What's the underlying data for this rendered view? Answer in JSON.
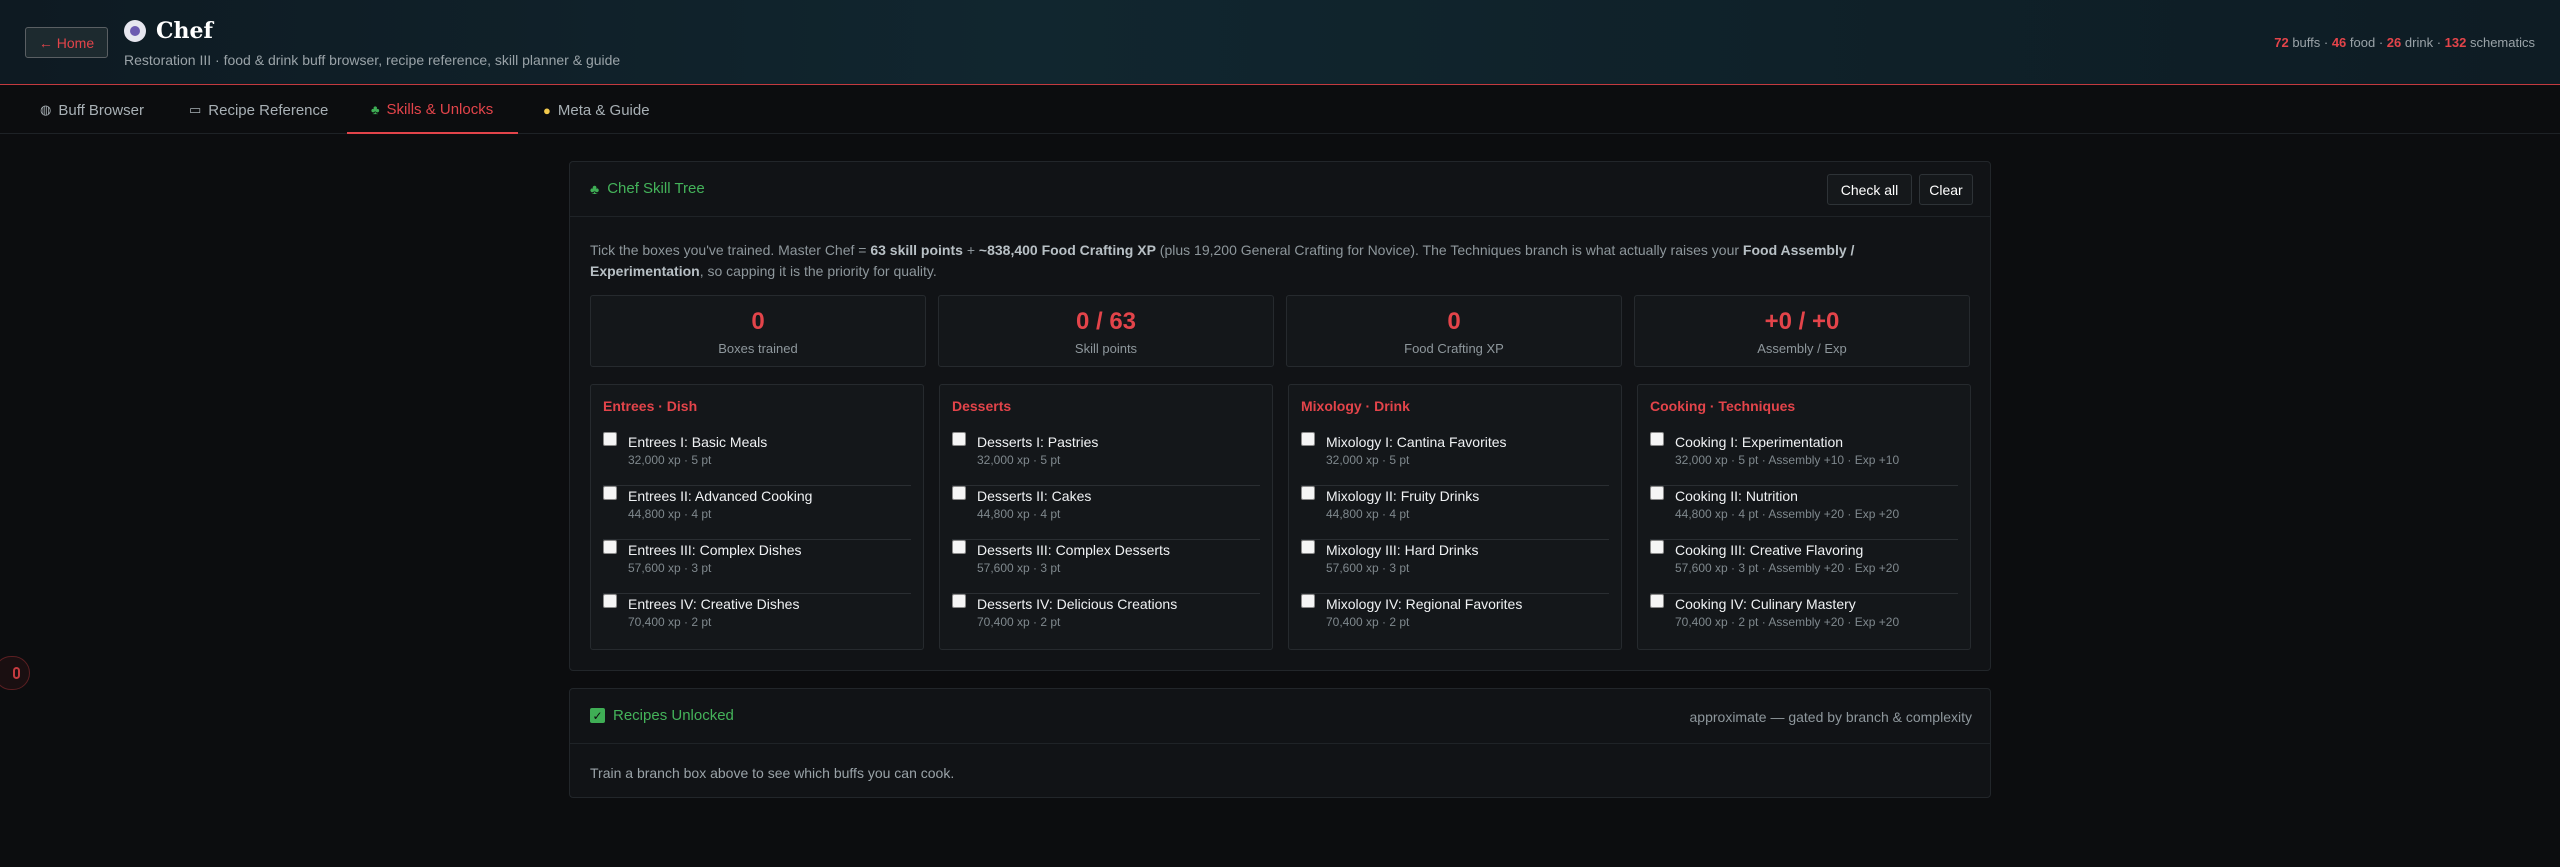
{
  "header": {
    "home_label": "← Home",
    "title": "Chef",
    "subtitle": "Restoration III · food & drink buff browser, recipe reference, skill planner & guide",
    "stats": {
      "buffs_count": "72",
      "buffs_label": "buffs",
      "food_count": "46",
      "food_label": "food",
      "drink_count": "26",
      "drink_label": "drink",
      "schematics_count": "132",
      "schematics_label": "schematics"
    }
  },
  "tabs": [
    {
      "label": "Buff Browser",
      "icon": "buff-icon",
      "active": false
    },
    {
      "label": "Recipe Reference",
      "icon": "book-icon",
      "active": false
    },
    {
      "label": "Skills & Unlocks",
      "icon": "tree-icon",
      "active": true
    },
    {
      "label": "Meta & Guide",
      "icon": "lightbulb-icon",
      "active": false
    }
  ],
  "skill_tree": {
    "title": "Chef Skill Tree",
    "check_all_label": "Check all",
    "clear_label": "Clear",
    "intro": {
      "p1": "Tick the boxes you've trained. Master Chef = ",
      "b1": "63 skill points",
      "p2": " + ",
      "b2": "~838,400 Food Crafting XP",
      "p3": " (plus 19,200 General Crafting for Novice). The Techniques branch is what actually raises your ",
      "b3": "Food Assembly / Experimentation",
      "p4": ", so capping it is the priority for quality."
    },
    "stat_cards": [
      {
        "value": "0",
        "label": "Boxes trained"
      },
      {
        "value": "0 / 63",
        "label": "Skill points"
      },
      {
        "value": "0",
        "label": "Food Crafting XP"
      },
      {
        "value": "+0 / +0",
        "label": "Assembly / Exp"
      }
    ],
    "branches": [
      {
        "title": "Entrees · Dish",
        "skills": [
          {
            "name": "Entrees I: Basic Meals",
            "meta": "32,000 xp · 5 pt",
            "checked": false
          },
          {
            "name": "Entrees II: Advanced Cooking",
            "meta": "44,800 xp · 4 pt",
            "checked": false
          },
          {
            "name": "Entrees III: Complex Dishes",
            "meta": "57,600 xp · 3 pt",
            "checked": false
          },
          {
            "name": "Entrees IV: Creative Dishes",
            "meta": "70,400 xp · 2 pt",
            "checked": false
          }
        ]
      },
      {
        "title": "Desserts",
        "skills": [
          {
            "name": "Desserts I: Pastries",
            "meta": "32,000 xp · 5 pt",
            "checked": false
          },
          {
            "name": "Desserts II: Cakes",
            "meta": "44,800 xp · 4 pt",
            "checked": false
          },
          {
            "name": "Desserts III: Complex Desserts",
            "meta": "57,600 xp · 3 pt",
            "checked": false
          },
          {
            "name": "Desserts IV: Delicious Creations",
            "meta": "70,400 xp · 2 pt",
            "checked": false
          }
        ]
      },
      {
        "title": "Mixology · Drink",
        "skills": [
          {
            "name": "Mixology I: Cantina Favorites",
            "meta": "32,000 xp · 5 pt",
            "checked": false
          },
          {
            "name": "Mixology II: Fruity Drinks",
            "meta": "44,800 xp · 4 pt",
            "checked": false
          },
          {
            "name": "Mixology III: Hard Drinks",
            "meta": "57,600 xp · 3 pt",
            "checked": false
          },
          {
            "name": "Mixology IV: Regional Favorites",
            "meta": "70,400 xp · 2 pt",
            "checked": false
          }
        ]
      },
      {
        "title": "Cooking · Techniques",
        "skills": [
          {
            "name": "Cooking I: Experimentation",
            "meta": "32,000 xp · 5 pt · Assembly +10 · Exp +10",
            "checked": false
          },
          {
            "name": "Cooking II: Nutrition",
            "meta": "44,800 xp · 4 pt · Assembly +20 · Exp +20",
            "checked": false
          },
          {
            "name": "Cooking III: Creative Flavoring",
            "meta": "57,600 xp · 3 pt · Assembly +20 · Exp +20",
            "checked": false
          },
          {
            "name": "Cooking IV: Culinary Mastery",
            "meta": "70,400 xp · 2 pt · Assembly +20 · Exp +20",
            "checked": false
          }
        ]
      }
    ]
  },
  "recipes": {
    "title": "Recipes Unlocked",
    "note": "approximate — gated by branch & complexity",
    "empty_message": "Train a branch box above to see which buffs you can cook."
  },
  "colors": {
    "accent": "#e3444a",
    "green": "#44b35a",
    "background": "#0c0d0f"
  }
}
